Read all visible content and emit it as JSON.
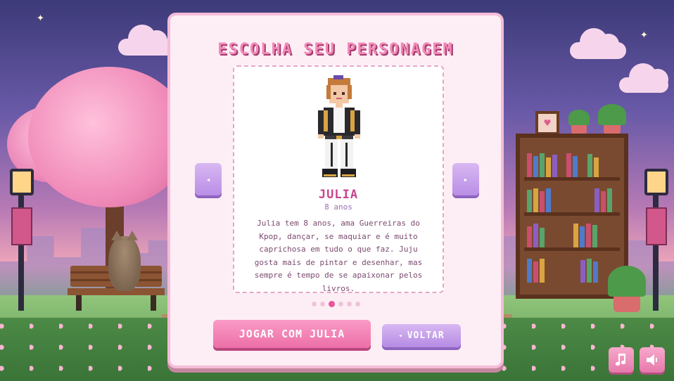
{
  "screen": {
    "title": "ESCOLHA SEU PERSONAGEM"
  },
  "character": {
    "name": "JULIA",
    "age": "8 anos",
    "description": "Julia tem 8 anos, ama Guerreiras do Kpop, dançar, se maquiar e é muito caprichosa em tudo o que faz. Juju gosta mais de pintar e desenhar, mas sempre é tempo de se apaixonar pelos livros.",
    "sprite_icon": "character-sprite"
  },
  "carousel": {
    "prev_glyph": "◂",
    "next_glyph": "▸",
    "total": 6,
    "active_index": 2
  },
  "actions": {
    "play_label": "JOGAR COM JULIA",
    "back_label": "VOLTAR",
    "back_glyph": "◂"
  },
  "controls": {
    "music_icon": "music-icon",
    "sound_icon": "speaker-icon",
    "music_glyph": "♫",
    "sound_glyph": "🔈"
  },
  "colors": {
    "accent_pink": "#ec6fa8",
    "accent_lilac": "#b98ee6",
    "title_pink": "#f28ab9",
    "name_pink": "#c8458b",
    "panel_bg": "#fdeef5"
  }
}
